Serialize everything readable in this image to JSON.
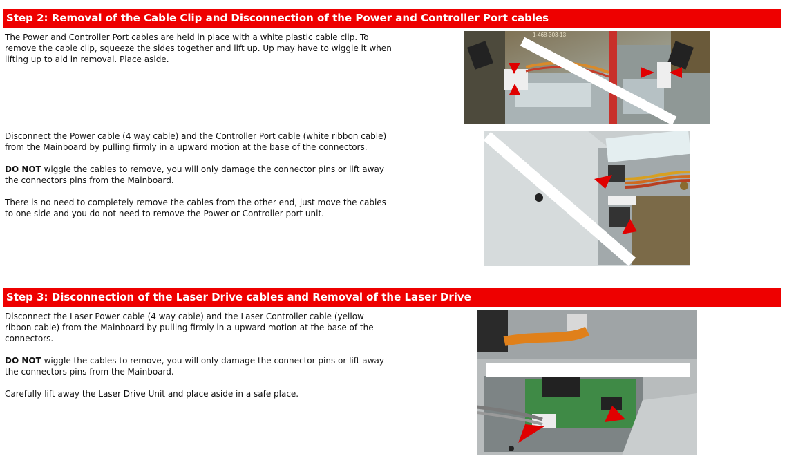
{
  "step2": {
    "title": "Step 2: Removal of the Cable Clip and Disconnection of the Power and Controller Port cables",
    "para1": "The Power and Controller Port cables are held in place with a white plastic cable clip. To remove the cable clip, squeeze the sides together and lift up. Up may have to wiggle it when lifting up to aid in removal. Place aside.",
    "para2": "Disconnect the Power cable (4 way cable) and the Controller Port cable (white ribbon cable) from the Mainboard by pulling firmly in a upward motion at the base of the connectors.",
    "para3_bold": "DO NOT",
    "para3_rest": " wiggle the cables to remove, you will only damage the connector pins or  lift away the connectors pins from the Mainboard.",
    "para4": "There is no need to completely remove the cables from the other end,  just move the cables to one side and you do not need to remove the Power or Controller port unit.",
    "photo1_label": "1-468-303-13"
  },
  "step3": {
    "title": "Step 3: Disconnection of the Laser Drive cables and Removal of the Laser Drive",
    "para1": "Disconnect the Laser Power cable (4 way cable) and the Laser Controller cable (yellow ribbon cable) from the Mainboard by pulling firmly in a upward motion at the base of the connectors.",
    "para2_bold": "DO NOT",
    "para2_rest": " wiggle the cables to remove, you will only damage the connector pins or  lift away the connectors pins from the Mainboard.",
    "para3": "Carefully lift away the Laser Drive Unit and place aside in a safe place."
  },
  "colors": {
    "header_bar": "#ee0000",
    "header_text": "#ffffff",
    "arrow": "#e00000"
  }
}
